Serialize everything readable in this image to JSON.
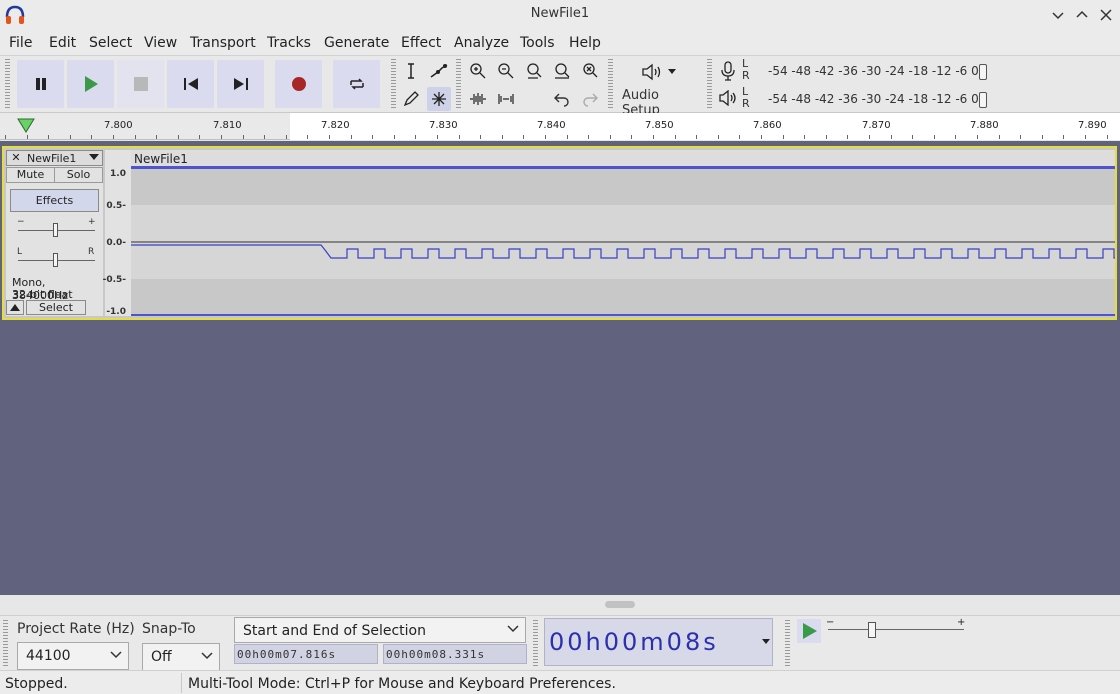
{
  "window": {
    "title": "NewFile1"
  },
  "menu": [
    "File",
    "Edit",
    "Select",
    "View",
    "Transport",
    "Tracks",
    "Generate",
    "Effect",
    "Analyze",
    "Tools",
    "Help"
  ],
  "toolbar": {
    "audio_setup_label": "Audio Setup"
  },
  "meters": {
    "record": {
      "l": "L",
      "r": "R",
      "scale": "-54 -48 -42 -36 -30 -24 -18 -12  -6  0"
    },
    "playback": {
      "l": "L",
      "r": "R",
      "scale": "-54 -48 -42 -36 -30 -24 -18 -12  -6  0"
    }
  },
  "ruler": {
    "labels": [
      "7.800",
      "7.810",
      "7.820",
      "7.830",
      "7.840",
      "7.850",
      "7.860",
      "7.870",
      "7.880",
      "7.890"
    ]
  },
  "track": {
    "name": "NewFile1",
    "mute_label": "Mute",
    "solo_label": "Solo",
    "effects_label": "Effects",
    "gain_minus": "−",
    "gain_plus": "+",
    "pan_left": "L",
    "pan_right": "R",
    "info_line1": "Mono, 384000Hz",
    "info_line2": "32-bit float",
    "select_label": "Select",
    "clip_name": "NewFile1",
    "vruler_labels": [
      "1.0",
      "0.5-",
      "0.0-",
      "-0.5-",
      "-1.0"
    ]
  },
  "selection_bar": {
    "project_rate_label": "Project Rate (Hz)",
    "project_rate_value": "44100",
    "snap_to_label": "Snap-To",
    "snap_to_value": "Off",
    "selection_mode": "Start and End of Selection",
    "start_time": "00h00m07.816s",
    "end_time": "00h00m08.331s",
    "audio_position": "00h00m08s"
  },
  "play_at_speed": {
    "minus": "−",
    "plus": "+"
  },
  "status": {
    "state": "Stopped.",
    "message": "Multi-Tool Mode: Ctrl+P for Mouse and Keyboard Preferences."
  },
  "colors": {
    "waveform": "#3a3fc4",
    "track_border": "#e3dd3e",
    "background": "#60627e",
    "record_button": "#a82626"
  }
}
